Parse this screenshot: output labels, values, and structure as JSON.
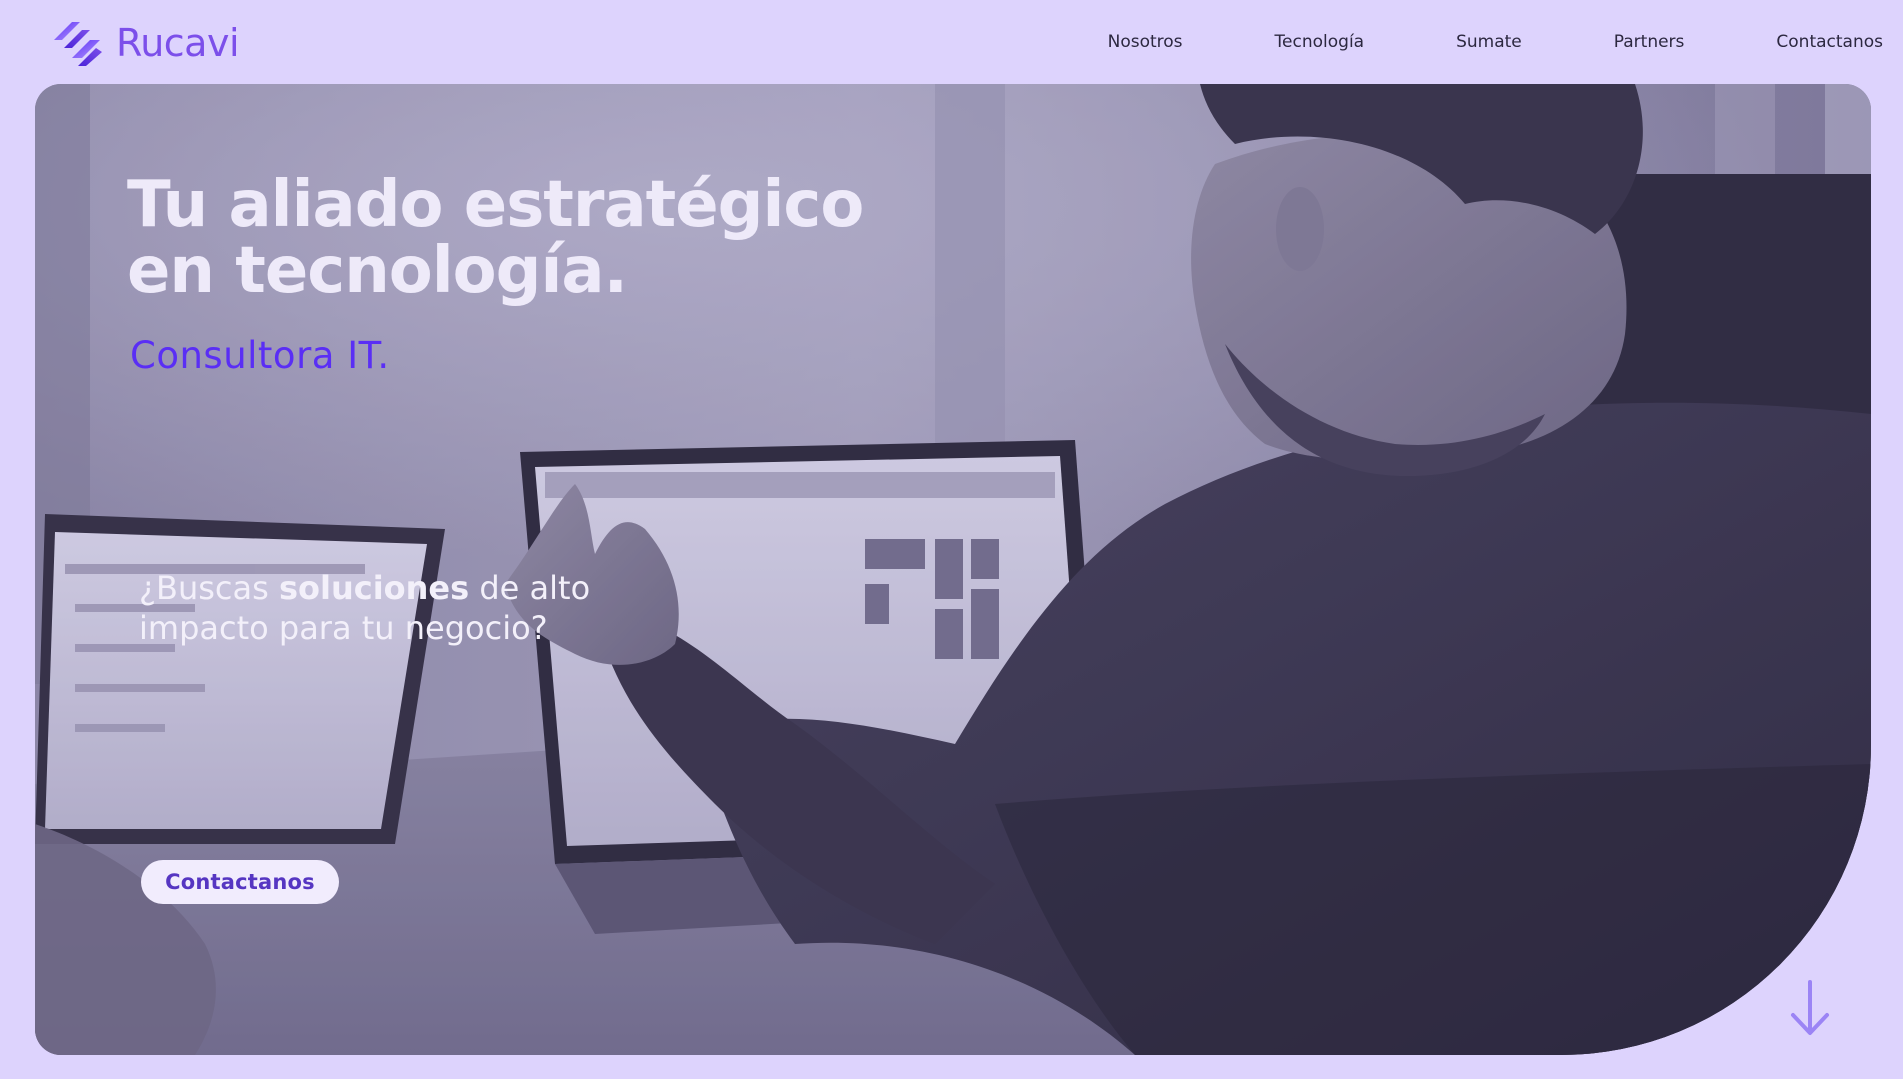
{
  "header": {
    "brand_name": "Rucavi",
    "logo_icon": "rucavi-logo-icon",
    "nav": [
      {
        "label": "Nosotros"
      },
      {
        "label": "Tecnología"
      },
      {
        "label": "Sumate"
      },
      {
        "label": "Partners"
      },
      {
        "label": "Contactanos"
      }
    ]
  },
  "hero": {
    "headline_line1": "Tu aliado estratégico",
    "headline_line2": "en tecnología.",
    "tagline": "Consultora IT.",
    "question_pre": "¿Buscas ",
    "question_bold": "soluciones",
    "question_post": " de alto",
    "question_line2": "impacto para tu negocio?",
    "cta_label": "Contactanos",
    "scroll_icon": "arrow-down-icon",
    "photo_description_icon": "office-photo"
  },
  "colors": {
    "page_bg": "#ddd3fd",
    "brand": "#7c4fea",
    "tagline": "#5a2ef5",
    "cta_bg": "#f1ecfd",
    "cta_text": "#5636c2",
    "arrow": "#9b84f5"
  }
}
